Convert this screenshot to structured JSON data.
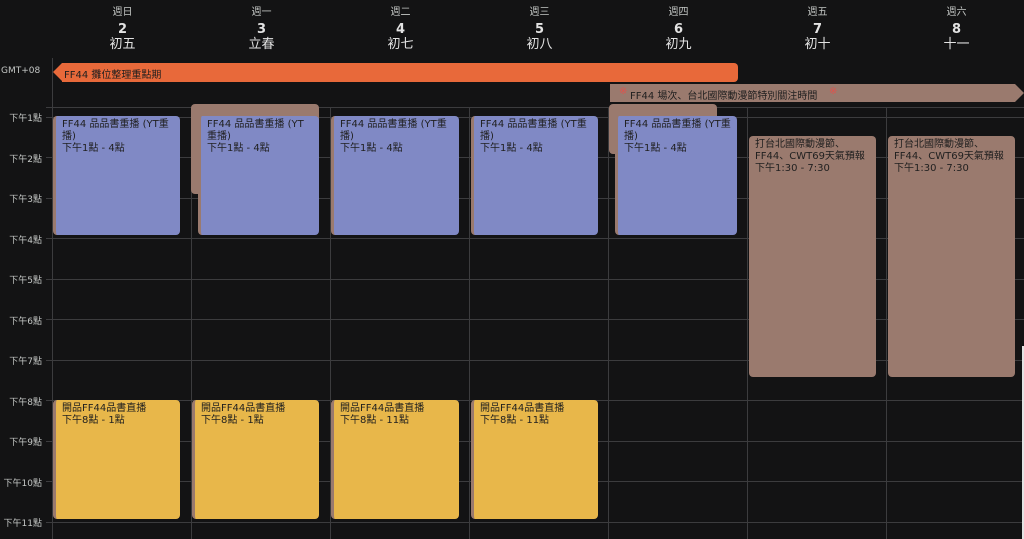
{
  "header": {
    "timezone": "GMT+08",
    "days": [
      {
        "dow": "週日",
        "date": "2",
        "lunar": "初五"
      },
      {
        "dow": "週一",
        "date": "3",
        "lunar": "立春"
      },
      {
        "dow": "週二",
        "date": "4",
        "lunar": "初七"
      },
      {
        "dow": "週三",
        "date": "5",
        "lunar": "初八"
      },
      {
        "dow": "週四",
        "date": "6",
        "lunar": "初九"
      },
      {
        "dow": "週五",
        "date": "7",
        "lunar": "初十"
      },
      {
        "dow": "週六",
        "date": "8",
        "lunar": "十一"
      }
    ]
  },
  "hours": [
    "下午1點",
    "下午2點",
    "下午3點",
    "下午4點",
    "下午5點",
    "下午6點",
    "下午7點",
    "下午8點",
    "下午9點",
    "下午10點",
    "下午11點"
  ],
  "allday": {
    "orange_title": "FF44 攤位整理重點期",
    "brown_title": "FF44 場次、台北國際動漫節特別關注時間",
    "brown_mark": "※"
  },
  "events": {
    "rerun_title": "FF44 品品書重播 (YT重播)",
    "rerun_time": "下午1點 - 4點",
    "live_title": "開品FF44品書直播",
    "live_time_1": "下午8點 - 1點",
    "live_time_2": "下午8點 - 11點",
    "comic_title": "打台北國際動漫節、FF44、CWT69天氣預報",
    "comic_time": "下午1:30 - 7:30"
  },
  "colors": {
    "orange": "#e8693a",
    "brown": "#9a7a6e",
    "purple": "#8089c5",
    "yellow": "#e8b74a",
    "background": "#131314"
  }
}
